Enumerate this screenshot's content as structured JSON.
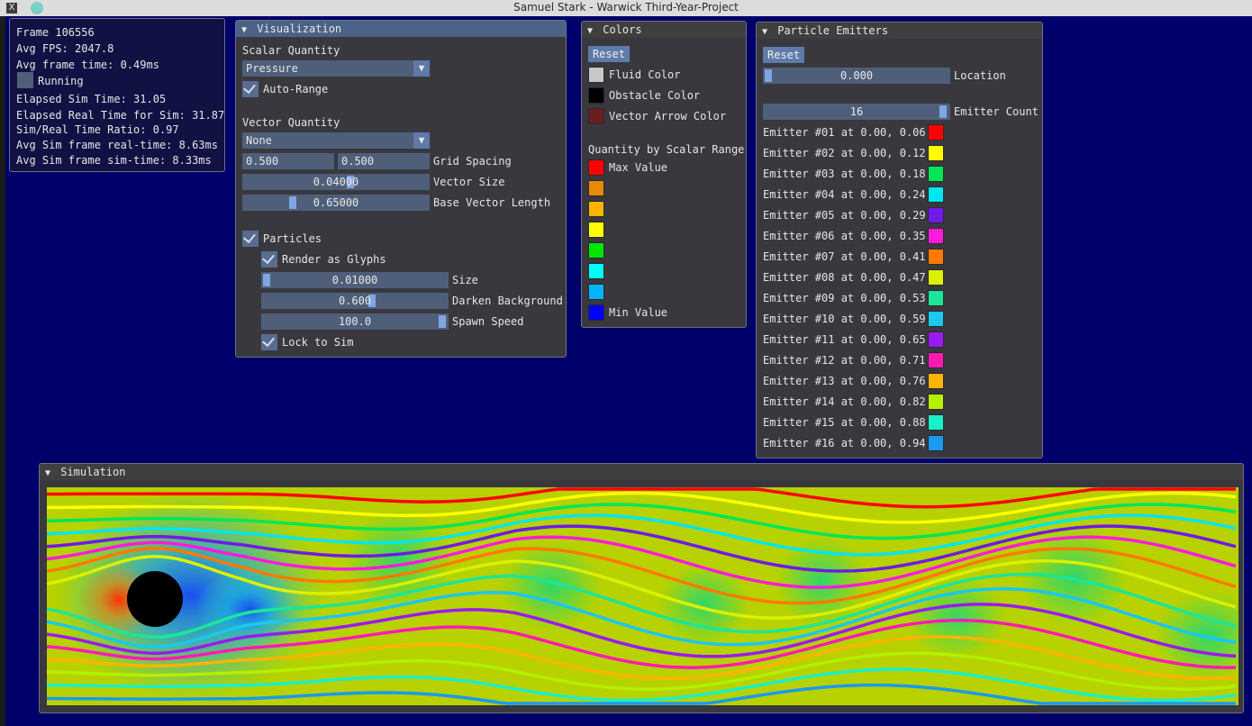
{
  "window_title": "Samuel Stark - Warwick Third-Year-Project",
  "stats": {
    "frame": "Frame 106556",
    "avg_fps": "Avg FPS: 2047.8",
    "avg_frame_time": "Avg frame time: 0.49ms",
    "running_label": "Running",
    "elapsed_sim": "Elapsed Sim Time: 31.05",
    "elapsed_real": "Elapsed Real Time for Sim: 31.87",
    "ratio": "Sim/Real Time Ratio: 0.97",
    "avg_real": "Avg Sim frame real-time: 8.63ms",
    "avg_sim": "Avg Sim frame sim-time: 8.33ms"
  },
  "visualization": {
    "title": "Visualization",
    "scalar_label": "Scalar Quantity",
    "scalar_value": "Pressure",
    "auto_range": "Auto-Range",
    "vector_label": "Vector Quantity",
    "vector_value": "None",
    "grid_x": "0.500",
    "grid_y": "0.500",
    "grid_spacing": "Grid Spacing",
    "vector_size_value": "0.04000",
    "vector_size": "Vector Size",
    "base_len_value": "0.65000",
    "base_len": "Base Vector Length",
    "particles": "Particles",
    "glyphs": "Render as Glyphs",
    "size_value": "0.01000",
    "size": "Size",
    "darken_value": "0.600",
    "darken": "Darken Background",
    "spawn_value": "100.0",
    "spawn": "Spawn Speed",
    "lock": "Lock to Sim"
  },
  "colors": {
    "title": "Colors",
    "reset": "Reset",
    "fluid": "Fluid Color",
    "obstacle": "Obstacle Color",
    "arrow": "Vector Arrow Color",
    "range_title": "Quantity by Scalar Range",
    "max": "Max Value",
    "min": "Min Value",
    "fluid_hex": "#c8c8c8",
    "obstacle_hex": "#000000",
    "arrow_hex": "#6b1d22",
    "scale_hex": [
      "#ff0000",
      "#e58a0a",
      "#ffb400",
      "#ffff00",
      "#00e600",
      "#00ffff",
      "#00b4ff",
      "#0000ff"
    ]
  },
  "emitters": {
    "title": "Particle Emitters",
    "reset": "Reset",
    "location_value": "0.000",
    "location": "Location",
    "count_value": "16",
    "count": "Emitter Count",
    "items": [
      {
        "label": "Emitter #01 at 0.00, 0.06",
        "color": "#ff0000"
      },
      {
        "label": "Emitter #02 at 0.00, 0.12",
        "color": "#ffff00"
      },
      {
        "label": "Emitter #03 at 0.00, 0.18",
        "color": "#00e65a"
      },
      {
        "label": "Emitter #04 at 0.00, 0.24",
        "color": "#00e6f0"
      },
      {
        "label": "Emitter #05 at 0.00, 0.29",
        "color": "#6f1ae6"
      },
      {
        "label": "Emitter #06 at 0.00, 0.35",
        "color": "#ff1adc"
      },
      {
        "label": "Emitter #07 at 0.00, 0.41",
        "color": "#ff7a00"
      },
      {
        "label": "Emitter #08 at 0.00, 0.47",
        "color": "#dcf000"
      },
      {
        "label": "Emitter #09 at 0.00, 0.53",
        "color": "#1ae69a"
      },
      {
        "label": "Emitter #10 at 0.00, 0.59",
        "color": "#1ac8f0"
      },
      {
        "label": "Emitter #11 at 0.00, 0.65",
        "color": "#9a1af0"
      },
      {
        "label": "Emitter #12 at 0.00, 0.71",
        "color": "#ff1ab4"
      },
      {
        "label": "Emitter #13 at 0.00, 0.76",
        "color": "#ffb400"
      },
      {
        "label": "Emitter #14 at 0.00, 0.82",
        "color": "#b4f000"
      },
      {
        "label": "Emitter #15 at 0.00, 0.88",
        "color": "#1af0c8"
      },
      {
        "label": "Emitter #16 at 0.00, 0.94",
        "color": "#1a9af0"
      }
    ]
  },
  "simulation": {
    "title": "Simulation"
  }
}
